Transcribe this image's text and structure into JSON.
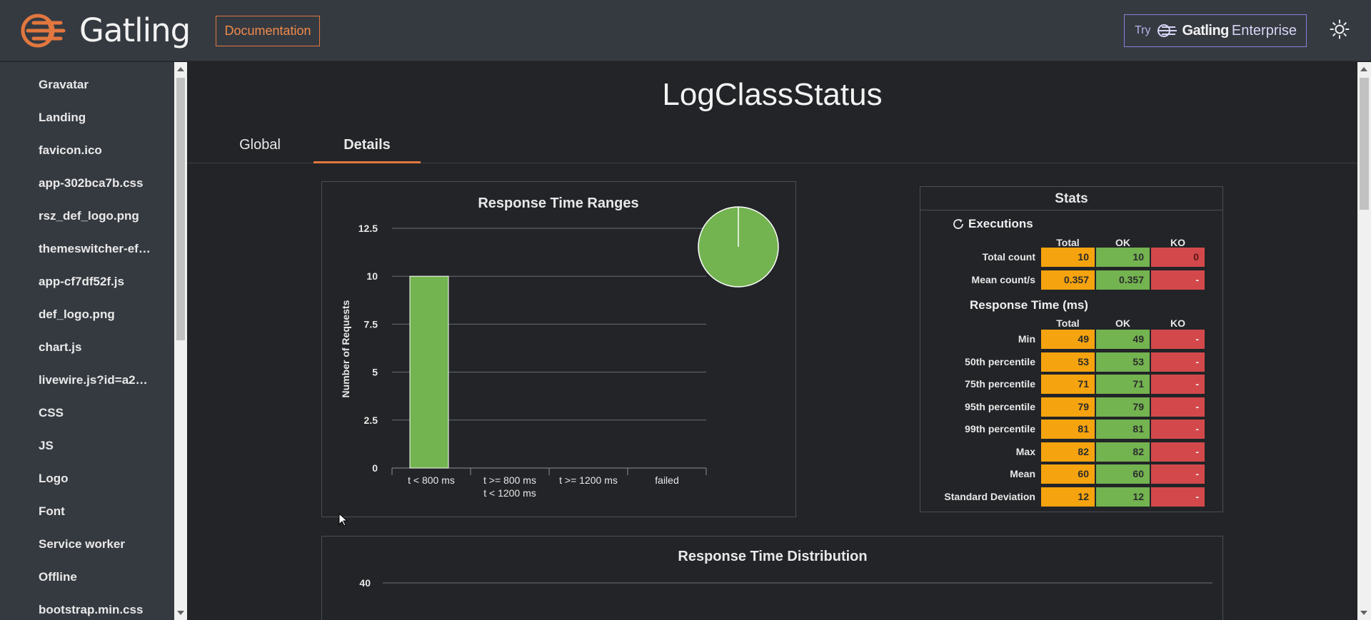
{
  "header": {
    "brand": "Gatling",
    "doc_button": "Documentation",
    "enterprise": {
      "try": "Try",
      "name": "Gatling",
      "sub": "Enterprise"
    },
    "accent": "#e2773f"
  },
  "sidebar": {
    "items": [
      "Gravatar",
      "Landing",
      "favicon.ico",
      "app-302bca7b.css",
      "rsz_def_logo.png",
      "themeswitcher-ef…",
      "app-cf7df52f.js",
      "def_logo.png",
      "chart.js",
      "livewire.js?id=a2…",
      "CSS",
      "JS",
      "Logo",
      "Font",
      "Service worker",
      "Offline",
      "bootstrap.min.css"
    ]
  },
  "main": {
    "title": "LogClassStatus",
    "tabs": [
      "Global",
      "Details"
    ],
    "active_tab": "Details"
  },
  "stats": {
    "title": "Stats",
    "executions_label": "Executions",
    "response_label": "Response Time (ms)",
    "cols": [
      "Total",
      "OK",
      "KO"
    ],
    "executions": [
      {
        "label": "Total count",
        "total": "10",
        "ok": "10",
        "ko": "0"
      },
      {
        "label": "Mean count/s",
        "total": "0.357",
        "ok": "0.357",
        "ko": "-"
      }
    ],
    "response": [
      {
        "label": "Min",
        "total": "49",
        "ok": "49",
        "ko": "-"
      },
      {
        "label": "50th percentile",
        "total": "53",
        "ok": "53",
        "ko": "-"
      },
      {
        "label": "75th percentile",
        "total": "71",
        "ok": "71",
        "ko": "-"
      },
      {
        "label": "95th percentile",
        "total": "79",
        "ok": "79",
        "ko": "-"
      },
      {
        "label": "99th percentile",
        "total": "81",
        "ok": "81",
        "ko": "-"
      },
      {
        "label": "Max",
        "total": "82",
        "ok": "82",
        "ko": "-"
      },
      {
        "label": "Mean",
        "total": "60",
        "ok": "60",
        "ko": "-"
      },
      {
        "label": "Standard Deviation",
        "total": "12",
        "ok": "12",
        "ko": "-"
      }
    ],
    "colors": {
      "total": "#f5a30e",
      "ok": "#73b350",
      "ko": "#d3494b"
    }
  },
  "chart_data": [
    {
      "type": "bar",
      "title": "Response Time Ranges",
      "ylabel": "Number of Requests",
      "categories": [
        "t < 800 ms",
        "t >= 800 ms\nt < 1200 ms",
        "t >= 1200 ms",
        "failed"
      ],
      "values": [
        10,
        0,
        0,
        0
      ],
      "ylim": [
        0,
        12.5
      ],
      "yticks": [
        "0",
        "2.5",
        "5",
        "7.5",
        "10",
        "12.5"
      ],
      "grid": true,
      "color": "#73b350",
      "inset_pie": {
        "values": [
          10,
          0,
          0,
          0
        ],
        "color": "#73b350"
      }
    },
    {
      "type": "bar",
      "title": "Response Time Distribution",
      "yticks": [
        "40"
      ]
    }
  ]
}
